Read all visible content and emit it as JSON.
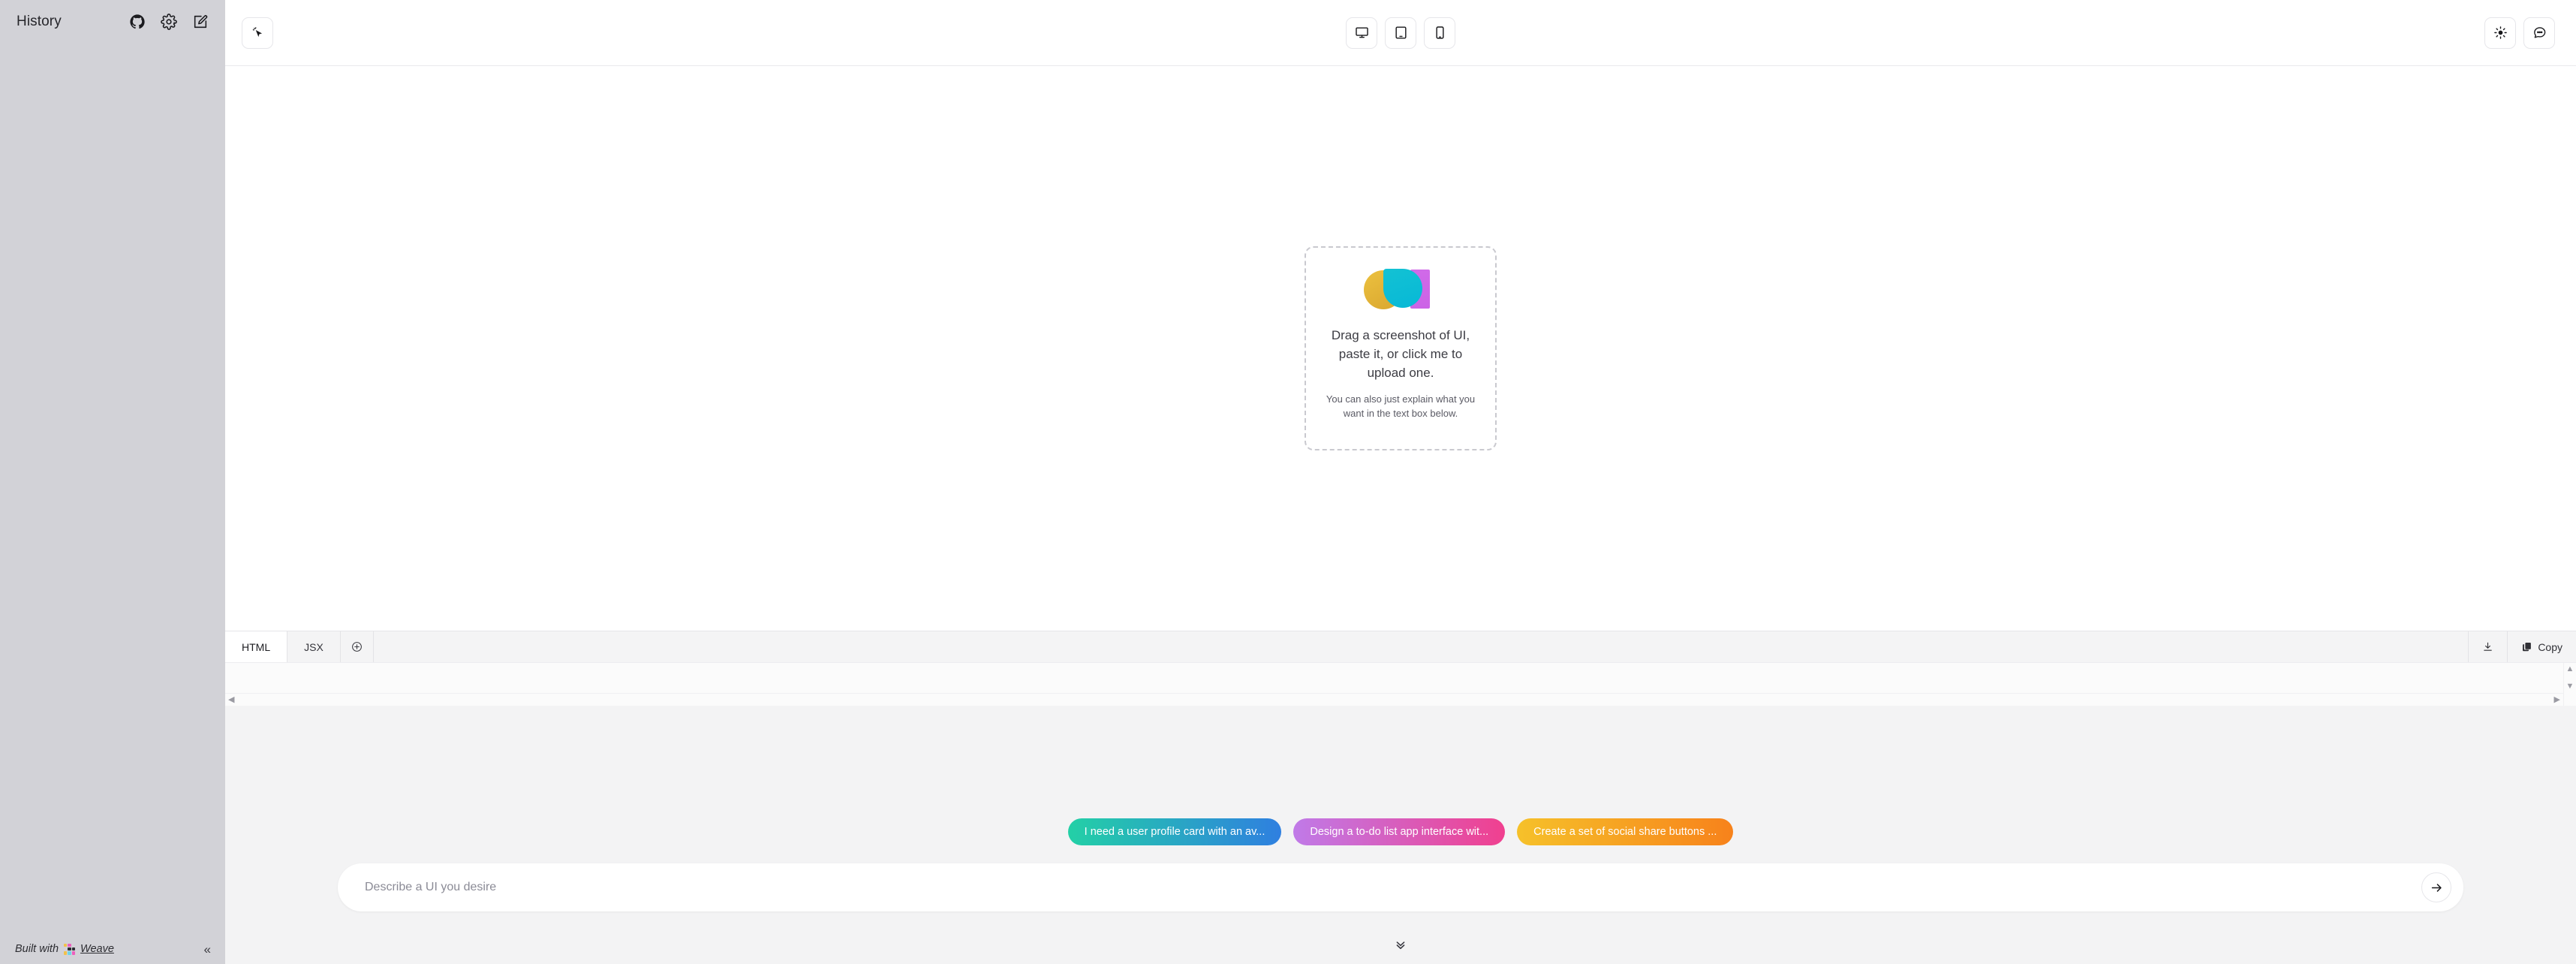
{
  "sidebar": {
    "title": "History",
    "icons": [
      {
        "name": "github-icon"
      },
      {
        "name": "settings-gear-icon"
      },
      {
        "name": "new-note-icon"
      }
    ],
    "footer": {
      "built_with_prefix": "Built with",
      "brand": "Weave",
      "collapse_label": "«",
      "mark_colors": [
        "#f2c14a",
        "#ec5fbd",
        "#ffffff",
        "#ffffff",
        "#2d2d33",
        "#2d2d33",
        "#f2c14a",
        "#6fd3e8",
        "#ec5fbd"
      ]
    }
  },
  "toolbar": {
    "select_tool": {
      "name": "cursor-select-icon"
    },
    "viewports": [
      {
        "name": "desktop-view",
        "label": "Desktop"
      },
      {
        "name": "tablet-view",
        "label": "Tablet"
      },
      {
        "name": "mobile-view",
        "label": "Mobile"
      }
    ],
    "right_actions": [
      {
        "name": "theme-toggle",
        "label": "Theme"
      },
      {
        "name": "chat-toggle",
        "label": "Chat"
      }
    ]
  },
  "canvas": {
    "dropzone": {
      "title": "Drag a screenshot of UI, paste it, or click me to upload one.",
      "subtitle": "You can also just explain what you want in the text box below.",
      "logo_colors": {
        "circle": "#e3b53a",
        "drop": "#0fbdd2",
        "bar": "#cd66e7"
      }
    }
  },
  "code_panel": {
    "tabs": [
      {
        "label": "HTML",
        "active": true
      },
      {
        "label": "JSX",
        "active": false
      }
    ],
    "add_tab_label": "+",
    "actions": [
      {
        "name": "download-button",
        "label": ""
      },
      {
        "name": "copy-button",
        "label": "Copy"
      }
    ]
  },
  "prompt": {
    "placeholder": "Describe a UI you desire",
    "value": "",
    "send_label": "Send",
    "suggestions": [
      {
        "label": "I need a user profile card with an av...",
        "gradient_from": "#23d0a6",
        "gradient_to": "#2f7fe0"
      },
      {
        "label": "Design a to-do list app interface wit...",
        "gradient_from": "#c07ae8",
        "gradient_to": "#f0408f"
      },
      {
        "label": "Create a set of social share buttons ...",
        "gradient_from": "#f6c12a",
        "gradient_to": "#f7821b"
      }
    ]
  },
  "scroll_down_hint": {
    "name": "chevron-double-down-icon"
  }
}
